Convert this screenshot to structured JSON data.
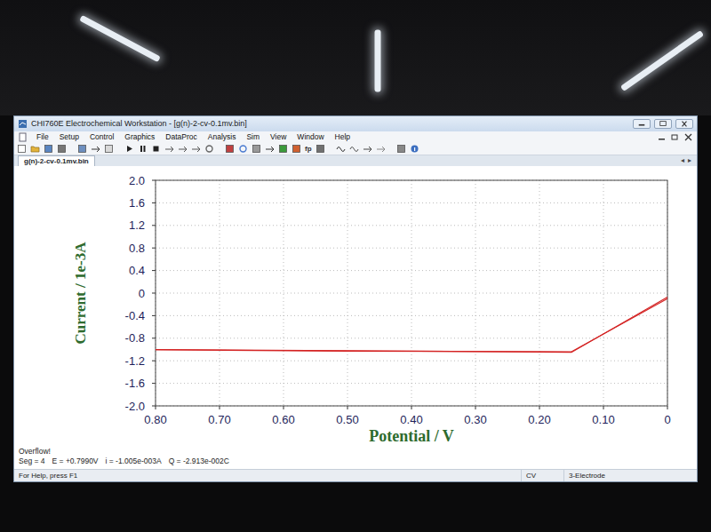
{
  "window": {
    "title": "CHI760E Electrochemical Workstation - [g(n)-2-cv-0.1mv.bin]"
  },
  "menu": [
    "File",
    "Setup",
    "Control",
    "Graphics",
    "DataProc",
    "Analysis",
    "Sim",
    "View",
    "Window",
    "Help"
  ],
  "toolbar": {
    "labels": [
      "fp"
    ]
  },
  "tabs": [
    {
      "label": "g(n)-2-cv-0.1mv.bin",
      "selected": true
    }
  ],
  "tab_nav": [
    "◂",
    "▸"
  ],
  "chart": {
    "y_title": "Current / 1e-3A",
    "x_title": "Potential / V",
    "y_ticks": [
      "2.0",
      "1.6",
      "1.2",
      "0.8",
      "0.4",
      "0",
      "-0.4",
      "-0.8",
      "-1.2",
      "-1.6",
      "-2.0"
    ],
    "x_ticks": [
      "0.80",
      "0.70",
      "0.60",
      "0.50",
      "0.40",
      "0.30",
      "0.20",
      "0.10",
      "0"
    ],
    "series": [
      {
        "potential": [
          0.8,
          0.5,
          0.15,
          0.0
        ],
        "current": [
          -1.0,
          -1.02,
          -1.05,
          -0.07
        ]
      },
      {
        "potential": [
          0.0,
          0.15,
          0.5,
          0.8
        ],
        "current": [
          -0.1,
          -1.04,
          -1.03,
          -1.005
        ]
      }
    ]
  },
  "messages": {
    "warning": "Overflow!",
    "readout": [
      "Seg = 4",
      "E = +0.7990V",
      "i = -1.005e-003A",
      "Q = -2.913e-002C"
    ]
  },
  "status_bar": [
    "For Help, press F1",
    "CV",
    "3-Electrode"
  ]
}
